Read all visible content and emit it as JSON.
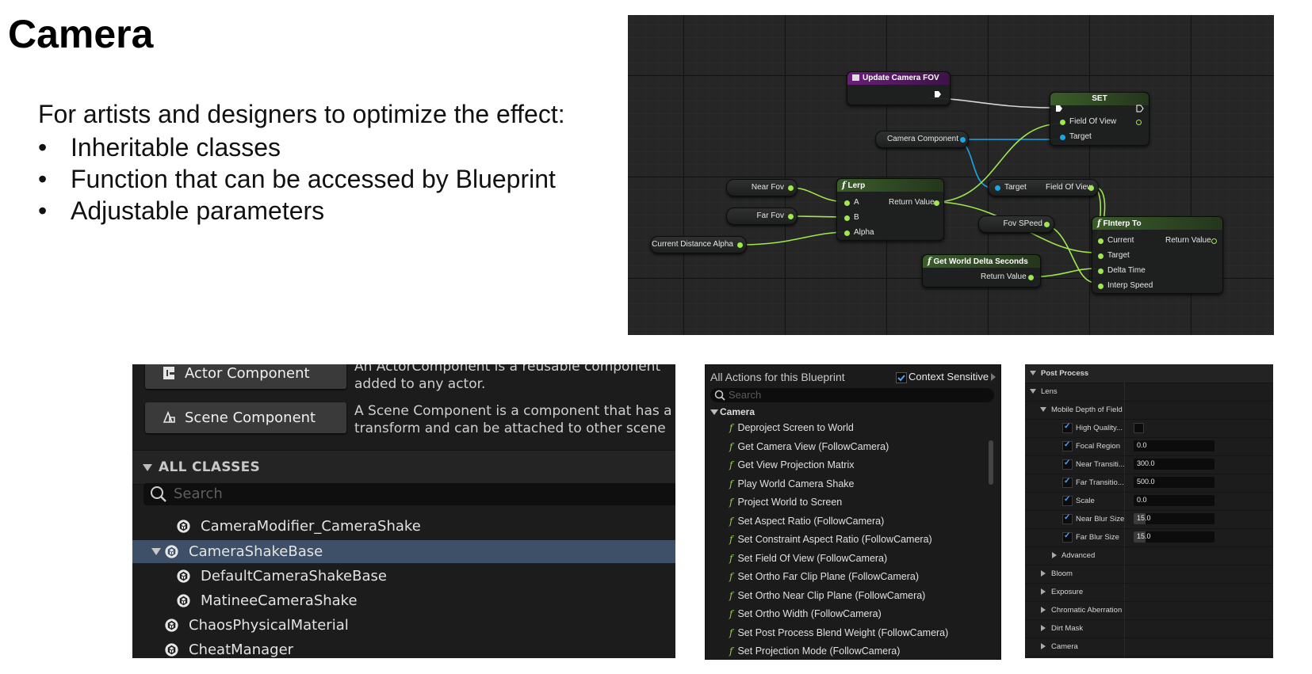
{
  "slide": {
    "title": "Camera",
    "intro": "For artists and designers to optimize the effect:",
    "bullets": [
      "Inheritable classes",
      "Function that can be accessed by Blueprint",
      "Adjustable parameters"
    ]
  },
  "blueprint": {
    "update_node": "Update Camera FOV",
    "set_node": "SET",
    "set_pins": [
      "Field Of View",
      "Target"
    ],
    "camera_component": "Camera Component",
    "lerp_node": "Lerp",
    "lerp_inputs": [
      "A",
      "B",
      "Alpha"
    ],
    "return_value": "Return Value",
    "near_fov": "Near Fov",
    "far_fov": "Far Fov",
    "current_distance_alpha": "Current Distance Alpha",
    "target_get": {
      "target": "Target",
      "field": "Field Of View"
    },
    "fov_speed": "Fov SPeed",
    "finterp_node": "FInterp To",
    "finterp_inputs": [
      "Current",
      "Target",
      "Delta Time",
      "Interp Speed"
    ],
    "delta_node": "Get World Delta Seconds",
    "function_glyph": "f"
  },
  "class_picker": {
    "common": [
      {
        "label": "Actor Component",
        "desc": [
          "An ActorComponent is a reusable component",
          "added to any actor."
        ],
        "icon": "actor-component-icon"
      },
      {
        "label": "Scene Component",
        "desc": [
          "A Scene Component is a component that has a",
          "transform and can be attached to other scene"
        ],
        "icon": "scene-component-icon"
      }
    ],
    "section": "ALL CLASSES",
    "search_placeholder": "Search",
    "items": [
      {
        "label": "CameraModifier_CameraShake",
        "indent": 1
      },
      {
        "label": "CameraShakeBase",
        "indent": 0,
        "expanded": true,
        "selected": true
      },
      {
        "label": "DefaultCameraShakeBase",
        "indent": 1
      },
      {
        "label": "MatineeCameraShake",
        "indent": 1
      },
      {
        "label": "ChaosPhysicalMaterial",
        "indent": 0
      },
      {
        "label": "CheatManager",
        "indent": 0
      }
    ],
    "selected_color": "#3d5068"
  },
  "actions": {
    "header": "All Actions for this Blueprint",
    "context_sensitive": "Context Sensitive",
    "context_checked": true,
    "search_placeholder": "Search",
    "category": "Camera",
    "items": [
      "Deproject Screen to World",
      "Get Camera View (FollowCamera)",
      "Get View Projection Matrix",
      "Play World Camera Shake",
      "Project World to Screen",
      "Set Aspect Ratio (FollowCamera)",
      "Set Constraint Aspect Ratio (FollowCamera)",
      "Set Field Of View (FollowCamera)",
      "Set Ortho Far Clip Plane (FollowCamera)",
      "Set Ortho Near Clip Plane (FollowCamera)",
      "Set Ortho Width (FollowCamera)",
      "Set Post Process Blend Weight (FollowCamera)",
      "Set Projection Mode (FollowCamera)"
    ]
  },
  "post_process": {
    "header": "Post Process",
    "lens": "Lens",
    "group": "Mobile Depth of Field",
    "props": [
      {
        "label": "High Quality...",
        "type": "checkbox",
        "value": false
      },
      {
        "label": "Focal Region",
        "type": "number",
        "value": "0.0"
      },
      {
        "label": "Near Transiti...",
        "type": "number",
        "value": "300.0"
      },
      {
        "label": "Far Transitio...",
        "type": "number",
        "value": "500.0"
      },
      {
        "label": "Scale",
        "type": "number",
        "value": "0.0"
      },
      {
        "label": "Near Blur Size",
        "type": "slider",
        "value": "15.0",
        "fill": 0.15
      },
      {
        "label": "Far Blur Size",
        "type": "slider",
        "value": "15.0",
        "fill": 0.15
      }
    ],
    "advanced": "Advanced",
    "collapsed_sections": [
      "Bloom",
      "Exposure",
      "Chromatic Aberration",
      "Dirt Mask",
      "Camera"
    ]
  }
}
